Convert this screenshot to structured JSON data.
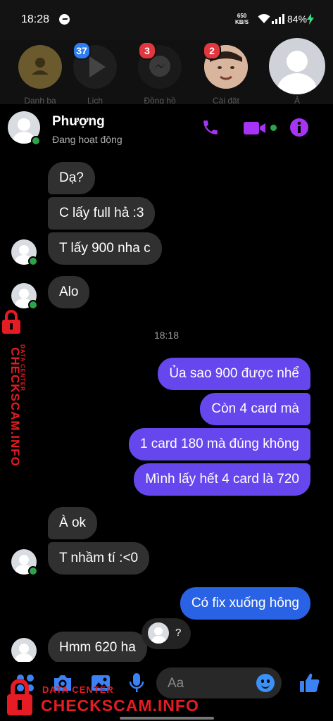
{
  "status_bar": {
    "time": "18:28",
    "speed_value": "650",
    "speed_unit": "KB/S",
    "battery": "84%"
  },
  "chat_heads": [
    {
      "label": "Danh ba",
      "badge": ""
    },
    {
      "label": "Lich",
      "badge": "37"
    },
    {
      "label": "Đồng hồ",
      "badge": "3"
    },
    {
      "label": "Cài đặt",
      "badge": "2"
    },
    {
      "label": "Ả",
      "badge": ""
    }
  ],
  "contact": {
    "name": "Phượng",
    "status": "Đang hoạt động"
  },
  "messages": [
    {
      "text": "Dạ?",
      "dir": "in"
    },
    {
      "text": "C lấy full hả :3",
      "dir": "in"
    },
    {
      "text": "T lấy 900 nha c",
      "dir": "in"
    },
    {
      "text": "Alo",
      "dir": "in"
    },
    {
      "text": "Ủa sao 900 được nhể",
      "dir": "out"
    },
    {
      "text": "Còn 4 card mà",
      "dir": "out"
    },
    {
      "text": "1 card 180 mà đúng không",
      "dir": "out"
    },
    {
      "text": "Mình lấy hết 4 card là 720",
      "dir": "out"
    },
    {
      "text": "À ok",
      "dir": "in"
    },
    {
      "text": "T nhầm tí :<0",
      "dir": "in"
    },
    {
      "text": "Có fix xuống hông",
      "dir": "out"
    },
    {
      "text": "Hmm 620 ha",
      "dir": "in"
    }
  ],
  "time_separator": "18:18",
  "reaction_text": "?",
  "composer": {
    "placeholder": "Aa"
  },
  "watermark": {
    "main": "CHECKSCAM.INFO",
    "sub": "DATA CENTER"
  },
  "colors": {
    "accent": "#a634f5",
    "outgoing": "#6547ed",
    "outgoing_blue": "#2a62e6",
    "incoming": "#303030",
    "online": "#31a24c",
    "watermark": "#e51c23"
  }
}
